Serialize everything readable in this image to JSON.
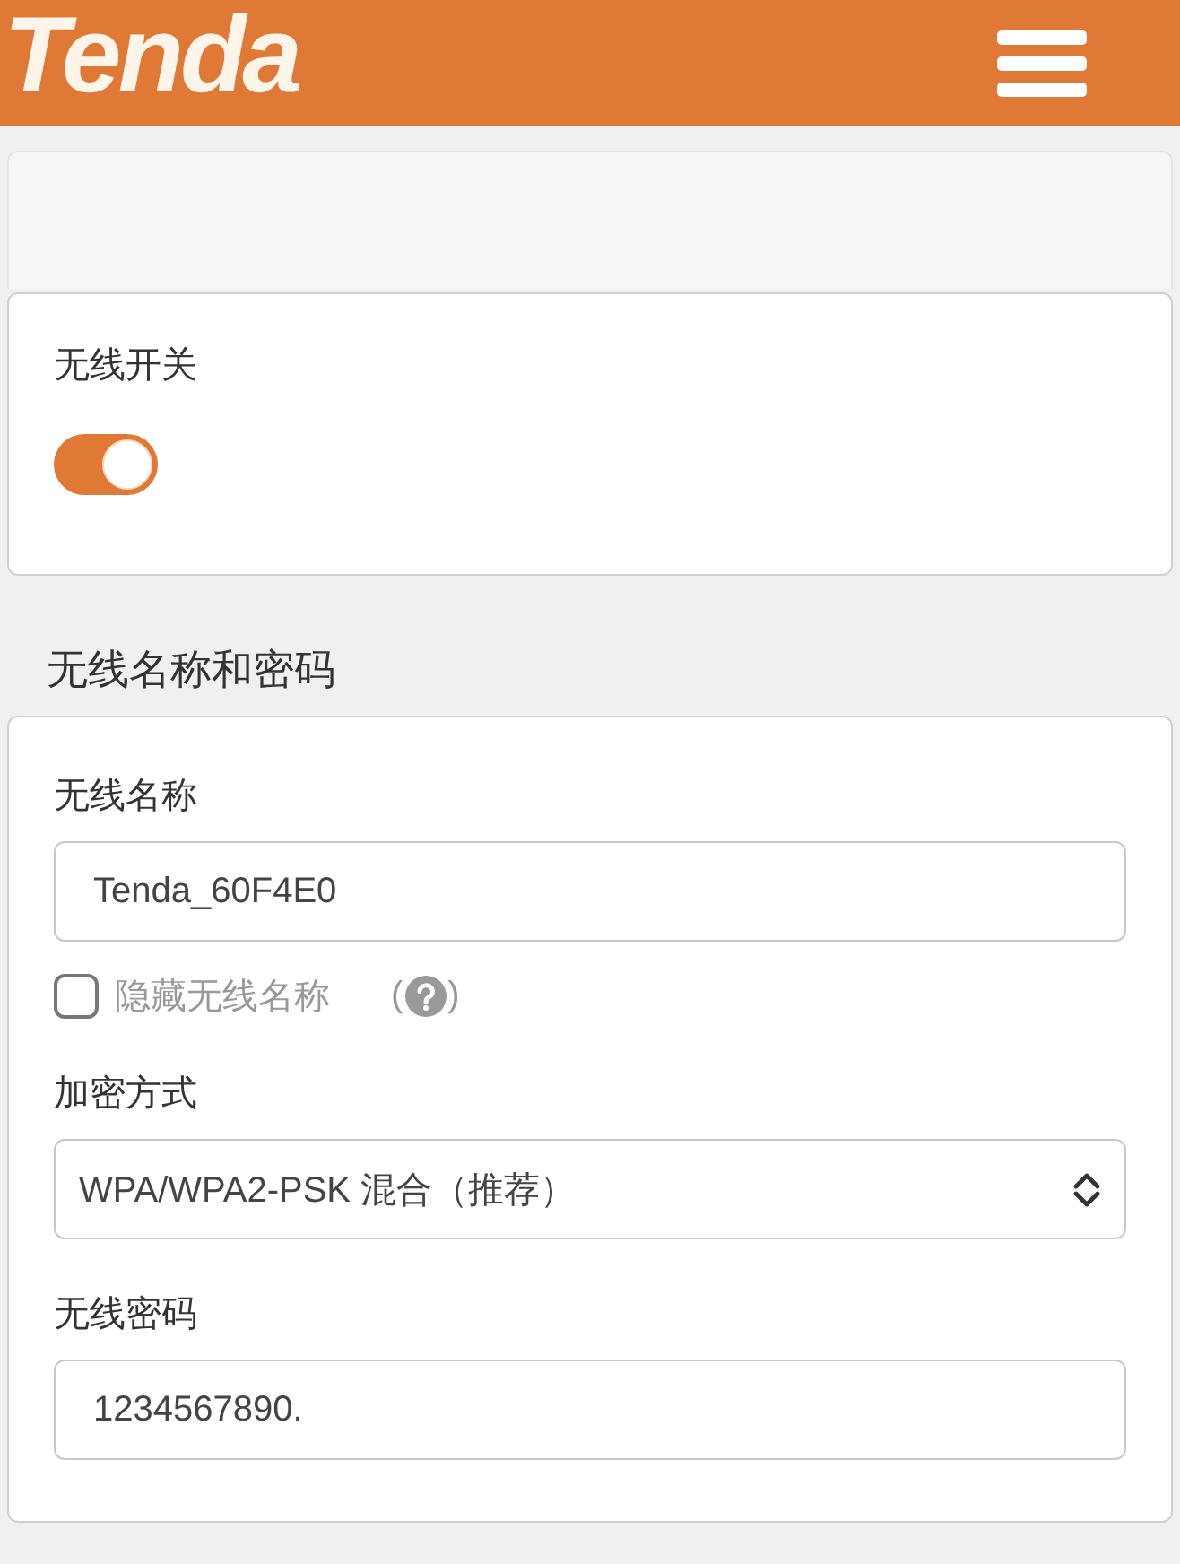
{
  "header": {
    "logo": "Tenda"
  },
  "wireless_switch": {
    "label": "无线开关",
    "on": true
  },
  "section_title": "无线名称和密码",
  "fields": [
    {
      "kind": "text",
      "label": "无线名称",
      "value": "Tenda_60F4E0",
      "option": {
        "label": "隐藏无线名称",
        "checked": false,
        "help_open": "(",
        "help_close": ")"
      }
    },
    {
      "kind": "select",
      "label": "加密方式",
      "value": "WPA/WPA2-PSK 混合（推荐）"
    },
    {
      "kind": "text",
      "label": "无线密码",
      "value": "1234567890."
    }
  ]
}
